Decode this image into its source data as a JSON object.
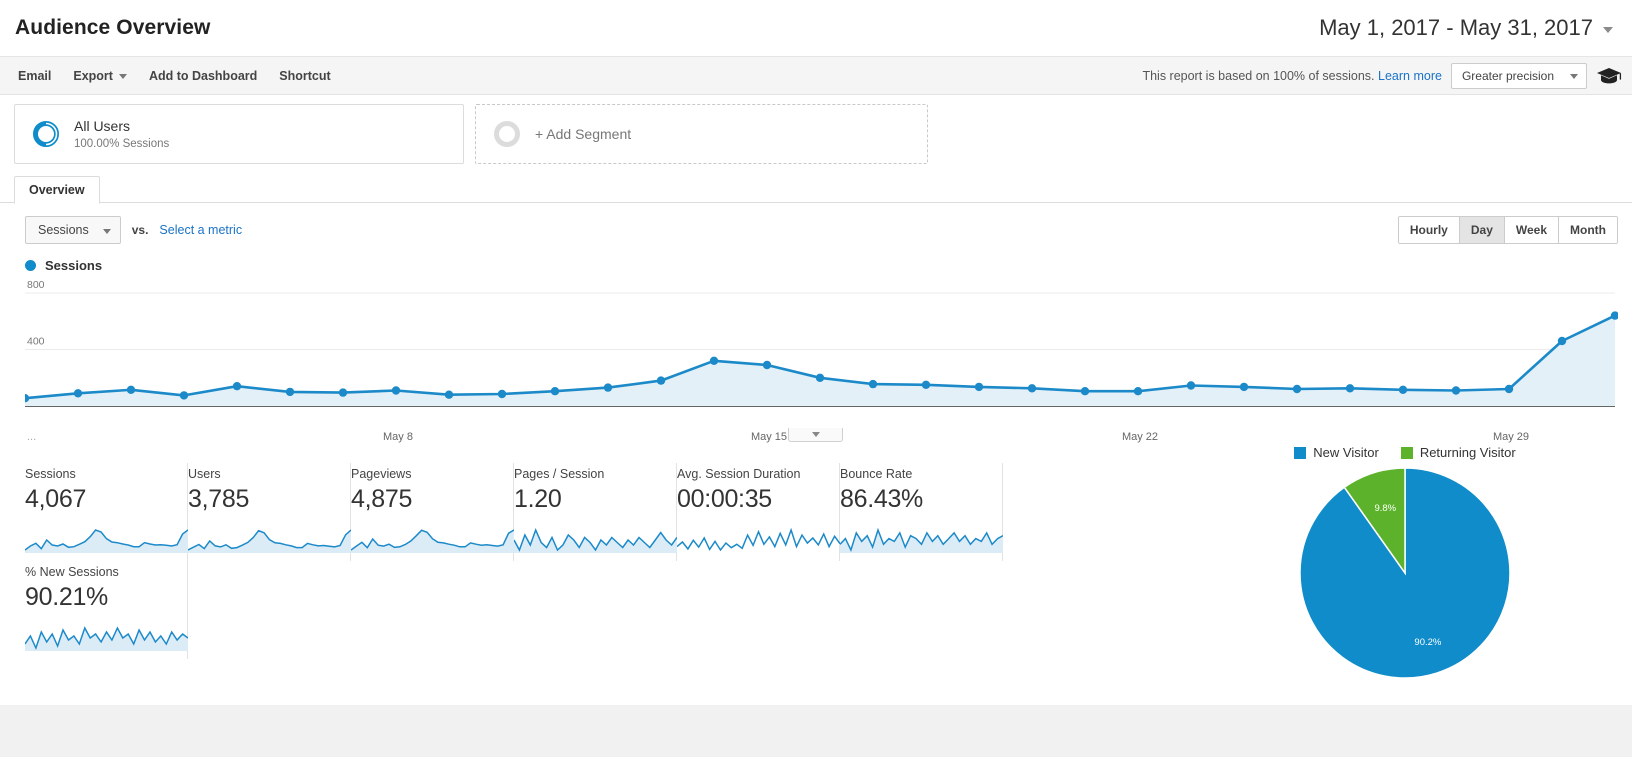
{
  "header": {
    "title": "Audience Overview",
    "date_range": "May 1, 2017 - May 31, 2017",
    "date_range_caret": "chevron-down-icon"
  },
  "toolbar": {
    "email_label": "Email",
    "export_label": "Export",
    "add_to_dashboard_label": "Add to Dashboard",
    "shortcut_label": "Shortcut",
    "sampling_text": "This report is based on 100% of sessions.",
    "learn_more_label": "Learn more",
    "precision_label": "Greater precision",
    "cap_icon": "graduation-cap-icon"
  },
  "segments": {
    "all_users": {
      "name": "All Users",
      "sub": "100.00% Sessions"
    },
    "add_segment_label": "+ Add Segment"
  },
  "tabs": [
    {
      "label": "Overview",
      "active": true
    }
  ],
  "controls": {
    "metric_selected": "Sessions",
    "vs_label": "vs.",
    "select_metric_label": "Select a metric",
    "granularity": [
      {
        "label": "Hourly",
        "active": false
      },
      {
        "label": "Day",
        "active": true
      },
      {
        "label": "Week",
        "active": false
      },
      {
        "label": "Month",
        "active": false
      }
    ]
  },
  "legend": {
    "series_label": "Sessions",
    "color": "#0f8cc9"
  },
  "chart_data": {
    "type": "line",
    "title": "Sessions",
    "xlabel": "",
    "ylabel": "Sessions",
    "ylim": [
      0,
      800
    ],
    "yticks": [
      400,
      800
    ],
    "grid": true,
    "legend_position": "top-left",
    "line_color": "#1c8ac9",
    "area_color": "#e3f0f8",
    "x_tick_labels": [
      "...",
      "May 8",
      "May 15",
      "May 22",
      "May 29"
    ],
    "x_tick_indices": [
      0,
      7,
      14,
      21,
      28
    ],
    "categories": [
      "May 1",
      "May 2",
      "May 3",
      "May 4",
      "May 5",
      "May 6",
      "May 7",
      "May 8",
      "May 9",
      "May 10",
      "May 11",
      "May 12",
      "May 13",
      "May 14",
      "May 15",
      "May 16",
      "May 17",
      "May 18",
      "May 19",
      "May 20",
      "May 21",
      "May 22",
      "May 23",
      "May 24",
      "May 25",
      "May 26",
      "May 27",
      "May 28",
      "May 29",
      "May 30",
      "May 31"
    ],
    "values": [
      55,
      90,
      115,
      75,
      140,
      100,
      95,
      110,
      80,
      85,
      105,
      130,
      180,
      320,
      290,
      200,
      155,
      150,
      135,
      125,
      105,
      105,
      145,
      135,
      120,
      125,
      115,
      110,
      120,
      460,
      640
    ]
  },
  "cards": [
    {
      "label": "Sessions",
      "value": "4,067",
      "spark": [
        40,
        52,
        60,
        44,
        70,
        55,
        52,
        58,
        48,
        50,
        57,
        65,
        80,
        100,
        94,
        74,
        64,
        62,
        58,
        55,
        50,
        50,
        62,
        58,
        55,
        56,
        54,
        52,
        56,
        88,
        100
      ],
      "fill": true
    },
    {
      "label": "Users",
      "value": "3,785",
      "spark": [
        42,
        50,
        58,
        46,
        68,
        54,
        51,
        57,
        47,
        49,
        56,
        64,
        78,
        98,
        92,
        72,
        63,
        61,
        57,
        54,
        49,
        49,
        61,
        57,
        54,
        55,
        53,
        51,
        55,
        86,
        100
      ],
      "fill": true
    },
    {
      "label": "Pageviews",
      "value": "4,875",
      "spark": [
        38,
        50,
        62,
        45,
        72,
        53,
        50,
        56,
        46,
        48,
        55,
        66,
        82,
        99,
        93,
        73,
        62,
        60,
        56,
        53,
        48,
        48,
        60,
        56,
        53,
        54,
        52,
        50,
        54,
        90,
        100
      ],
      "fill": true
    },
    {
      "label": "Pages / Session",
      "value": "1.20",
      "spark": [
        62,
        58,
        64,
        60,
        66,
        61,
        59,
        63,
        58,
        60,
        64,
        62,
        59,
        63,
        61,
        58,
        62,
        60,
        63,
        61,
        59,
        62,
        60,
        63,
        61,
        59,
        62,
        65,
        62,
        60,
        63
      ],
      "fill": true
    },
    {
      "label": "Avg. Session Duration",
      "value": "00:00:35",
      "spark": [
        30,
        46,
        22,
        52,
        28,
        60,
        20,
        48,
        18,
        42,
        26,
        38,
        24,
        70,
        34,
        82,
        38,
        64,
        30,
        76,
        36,
        88,
        30,
        70,
        42,
        60,
        36,
        74,
        30,
        66,
        40
      ],
      "fill": false
    },
    {
      "label": "Bounce Rate",
      "value": "86.43%",
      "spark": [
        78,
        80,
        76,
        82,
        79,
        81,
        77,
        83,
        78,
        80,
        79,
        82,
        77,
        81,
        80,
        78,
        82,
        79,
        81,
        78,
        80,
        82,
        79,
        81,
        78,
        80,
        79,
        82,
        78,
        80,
        81
      ],
      "fill": true
    },
    {
      "label": "% New Sessions",
      "value": "90.21%",
      "spark": [
        70,
        74,
        68,
        76,
        71,
        75,
        69,
        77,
        72,
        74,
        70,
        78,
        73,
        75,
        71,
        76,
        72,
        78,
        73,
        75,
        70,
        77,
        72,
        76,
        71,
        74,
        70,
        76,
        72,
        75,
        73
      ],
      "fill": true
    }
  ],
  "pie": {
    "legend": [
      {
        "label": "New Visitor",
        "color": "#0f8cc9"
      },
      {
        "label": "Returning Visitor",
        "color": "#5cb32b"
      }
    ],
    "chart_data": {
      "type": "pie",
      "title": "",
      "labels": [
        "New Visitor",
        "Returning Visitor"
      ],
      "values": [
        90.2,
        9.8
      ],
      "value_labels": [
        "90.2%",
        "9.8%"
      ],
      "colors": [
        "#0f8cc9",
        "#5cb32b"
      ],
      "legend_position": "top"
    }
  }
}
